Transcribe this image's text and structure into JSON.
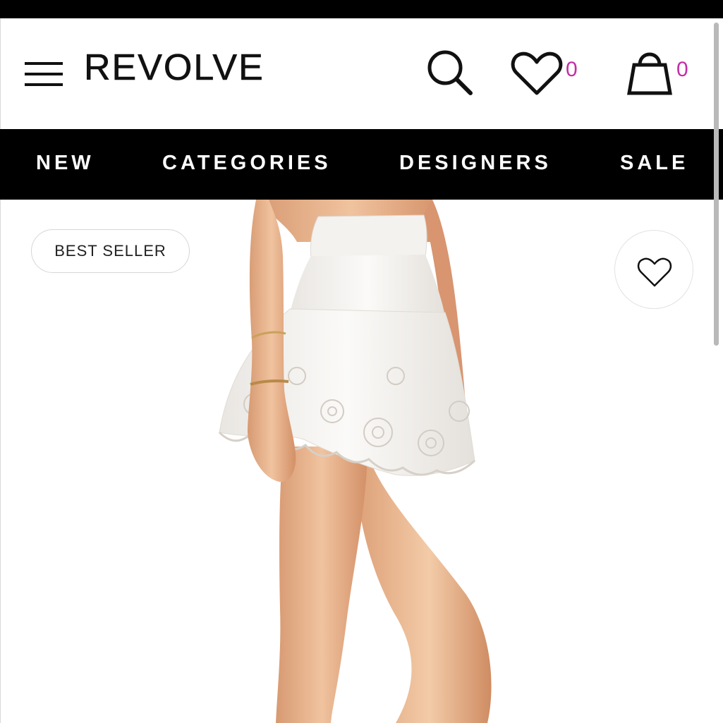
{
  "header": {
    "brand": "REVOLVE",
    "wishlist_count": "0",
    "bag_count": "0"
  },
  "nav": {
    "items": [
      "NEW",
      "CATEGORIES",
      "DESIGNERS",
      "SALE"
    ]
  },
  "product": {
    "badge": "BEST SELLER"
  },
  "colors": {
    "accent": "#c32fa6",
    "nav_background": "#000000",
    "text": "#111111"
  },
  "icons": {
    "menu": "hamburger-menu-icon",
    "search": "search-icon",
    "wishlist": "heart-icon",
    "bag": "shopping-bag-icon",
    "favorite": "heart-outline-icon"
  }
}
